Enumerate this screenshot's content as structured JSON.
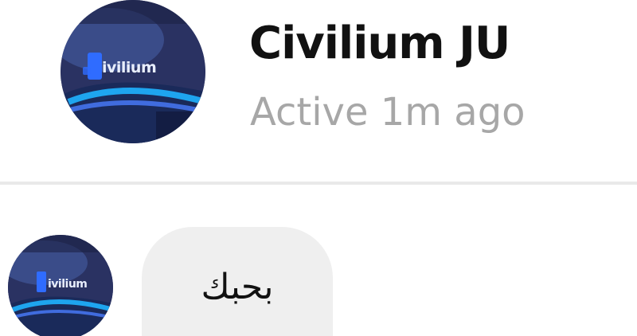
{
  "contact": {
    "name": "Civilium JU",
    "status": "Active 1m ago",
    "avatar_logo_text": "ivilium",
    "avatar_logo_text_small": "ivilium"
  },
  "messages": [
    {
      "text": "بحبك",
      "from": "contact"
    }
  ],
  "colors": {
    "background": "#ffffff",
    "name": "#111111",
    "status": "#a7a7a7",
    "bubble": "#efefef",
    "divider": "#e9e9e9",
    "avatar_dark": "#1c2244",
    "avatar_accent": "#2f6cff"
  }
}
